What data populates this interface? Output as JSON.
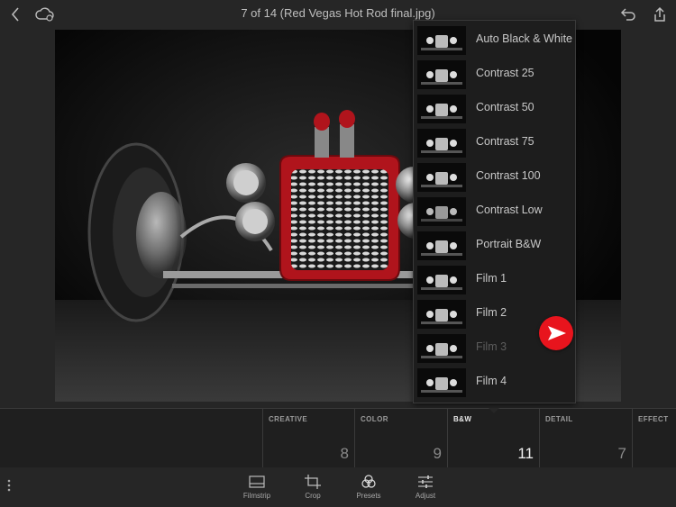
{
  "header": {
    "title": "7 of 14 (Red Vegas Hot Rod final.jpg)",
    "back_icon": "chevron-left-icon",
    "cloud_icon": "cloud-sync-icon",
    "undo_icon": "undo-icon"
  },
  "presets_menu": {
    "items": [
      {
        "label": "Auto Black & White",
        "dim": false
      },
      {
        "label": "Contrast 25",
        "dim": false
      },
      {
        "label": "Contrast 50",
        "dim": false
      },
      {
        "label": "Contrast 75",
        "dim": false
      },
      {
        "label": "Contrast 100",
        "dim": false
      },
      {
        "label": "Contrast Low",
        "dim": false
      },
      {
        "label": "Portrait B&W",
        "dim": false
      },
      {
        "label": "Film 1",
        "dim": false
      },
      {
        "label": "Film 2",
        "dim": false
      },
      {
        "label": "Film 3",
        "dim": true
      },
      {
        "label": "Film 4",
        "dim": false
      }
    ]
  },
  "categories": [
    {
      "name": "CREATIVE",
      "count": "8",
      "active": false
    },
    {
      "name": "COLOR",
      "count": "9",
      "active": false
    },
    {
      "name": "B&W",
      "count": "11",
      "active": true
    },
    {
      "name": "DETAIL",
      "count": "7",
      "active": false
    },
    {
      "name": "EFFECT",
      "count": "",
      "active": false
    }
  ],
  "toolbar": {
    "filmstrip": "Filmstrip",
    "crop": "Crop",
    "presets": "Presets",
    "adjust": "Adjust"
  },
  "colors": {
    "accent_red": "#e8141d",
    "car_red": "#b0141c",
    "background": "#262626"
  }
}
